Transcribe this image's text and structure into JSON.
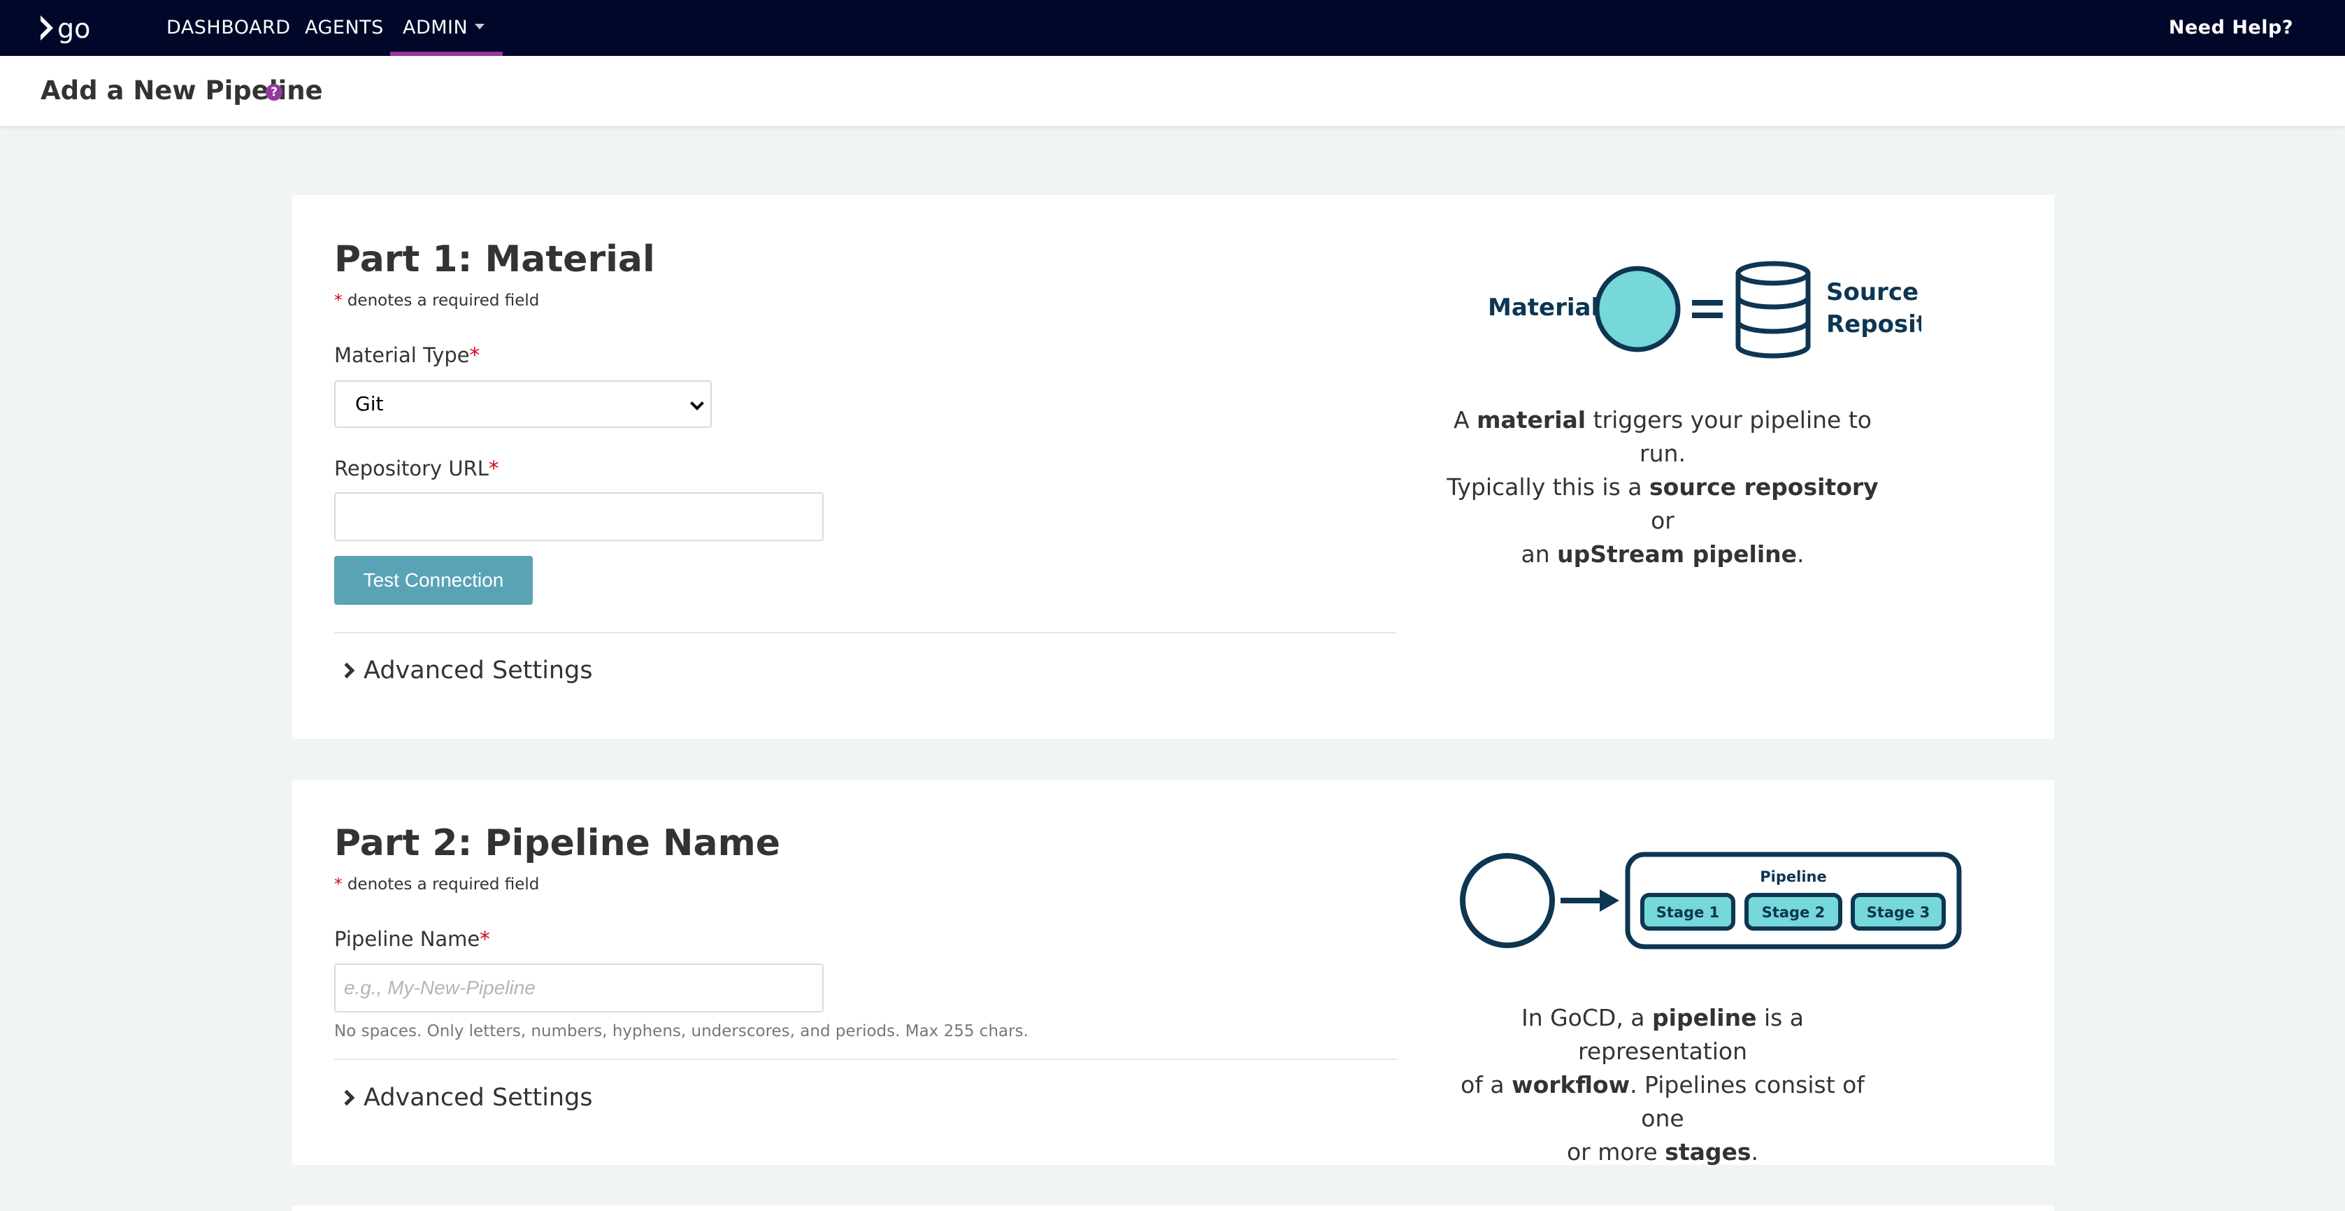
{
  "nav": {
    "logo_text": "go",
    "dashboard": "DASHBOARD",
    "agents": "AGENTS",
    "admin": "ADMIN",
    "help": "Need Help?"
  },
  "header": {
    "title": "Add a New Pipeline",
    "help_icon": "?"
  },
  "part1": {
    "title": "Part 1: Material",
    "required_star": "*",
    "required_note": "denotes a required field",
    "material_type_label": "Material Type",
    "material_type_value": "Git",
    "repo_url_label": "Repository URL",
    "repo_url_value": "",
    "test_button": "Test Connection",
    "advanced": "Advanced Settings",
    "diagram": {
      "left_label": "Material",
      "right_label_1": "Source",
      "right_label_2": "Repository"
    },
    "desc": {
      "t1": "A ",
      "b1": "material",
      "t2": " triggers your pipeline to run.",
      "t3": "Typically this is a ",
      "b2": "source repository",
      "t4": " or",
      "t5": "an ",
      "b3": "upStream pipeline",
      "t6": "."
    }
  },
  "part2": {
    "title": "Part 2: Pipeline Name",
    "required_star": "*",
    "required_note": "denotes a required field",
    "pipeline_name_label": "Pipeline Name",
    "pipeline_name_placeholder": "e.g., My-New-Pipeline",
    "hint": "No spaces. Only letters, numbers, hyphens, underscores, and periods. Max 255 chars.",
    "advanced": "Advanced Settings",
    "diagram": {
      "pipeline_label": "Pipeline",
      "stages": [
        "Stage 1",
        "Stage 2",
        "Stage 3"
      ]
    },
    "desc": {
      "t1": "In GoCD, a ",
      "b1": "pipeline",
      "t2": " is a representation",
      "t3": "of a ",
      "b2": "workflow",
      "t4": ". Pipelines consist of one",
      "t5": "or more ",
      "b3": "stages",
      "t6": "."
    }
  },
  "colors": {
    "nav_bg": "#000728",
    "accent_purple": "#943a9e",
    "button_teal": "#5aa3b6",
    "diagram_fill": "#76d8d8",
    "diagram_stroke": "#0d3653",
    "required_red": "#d0021b"
  }
}
